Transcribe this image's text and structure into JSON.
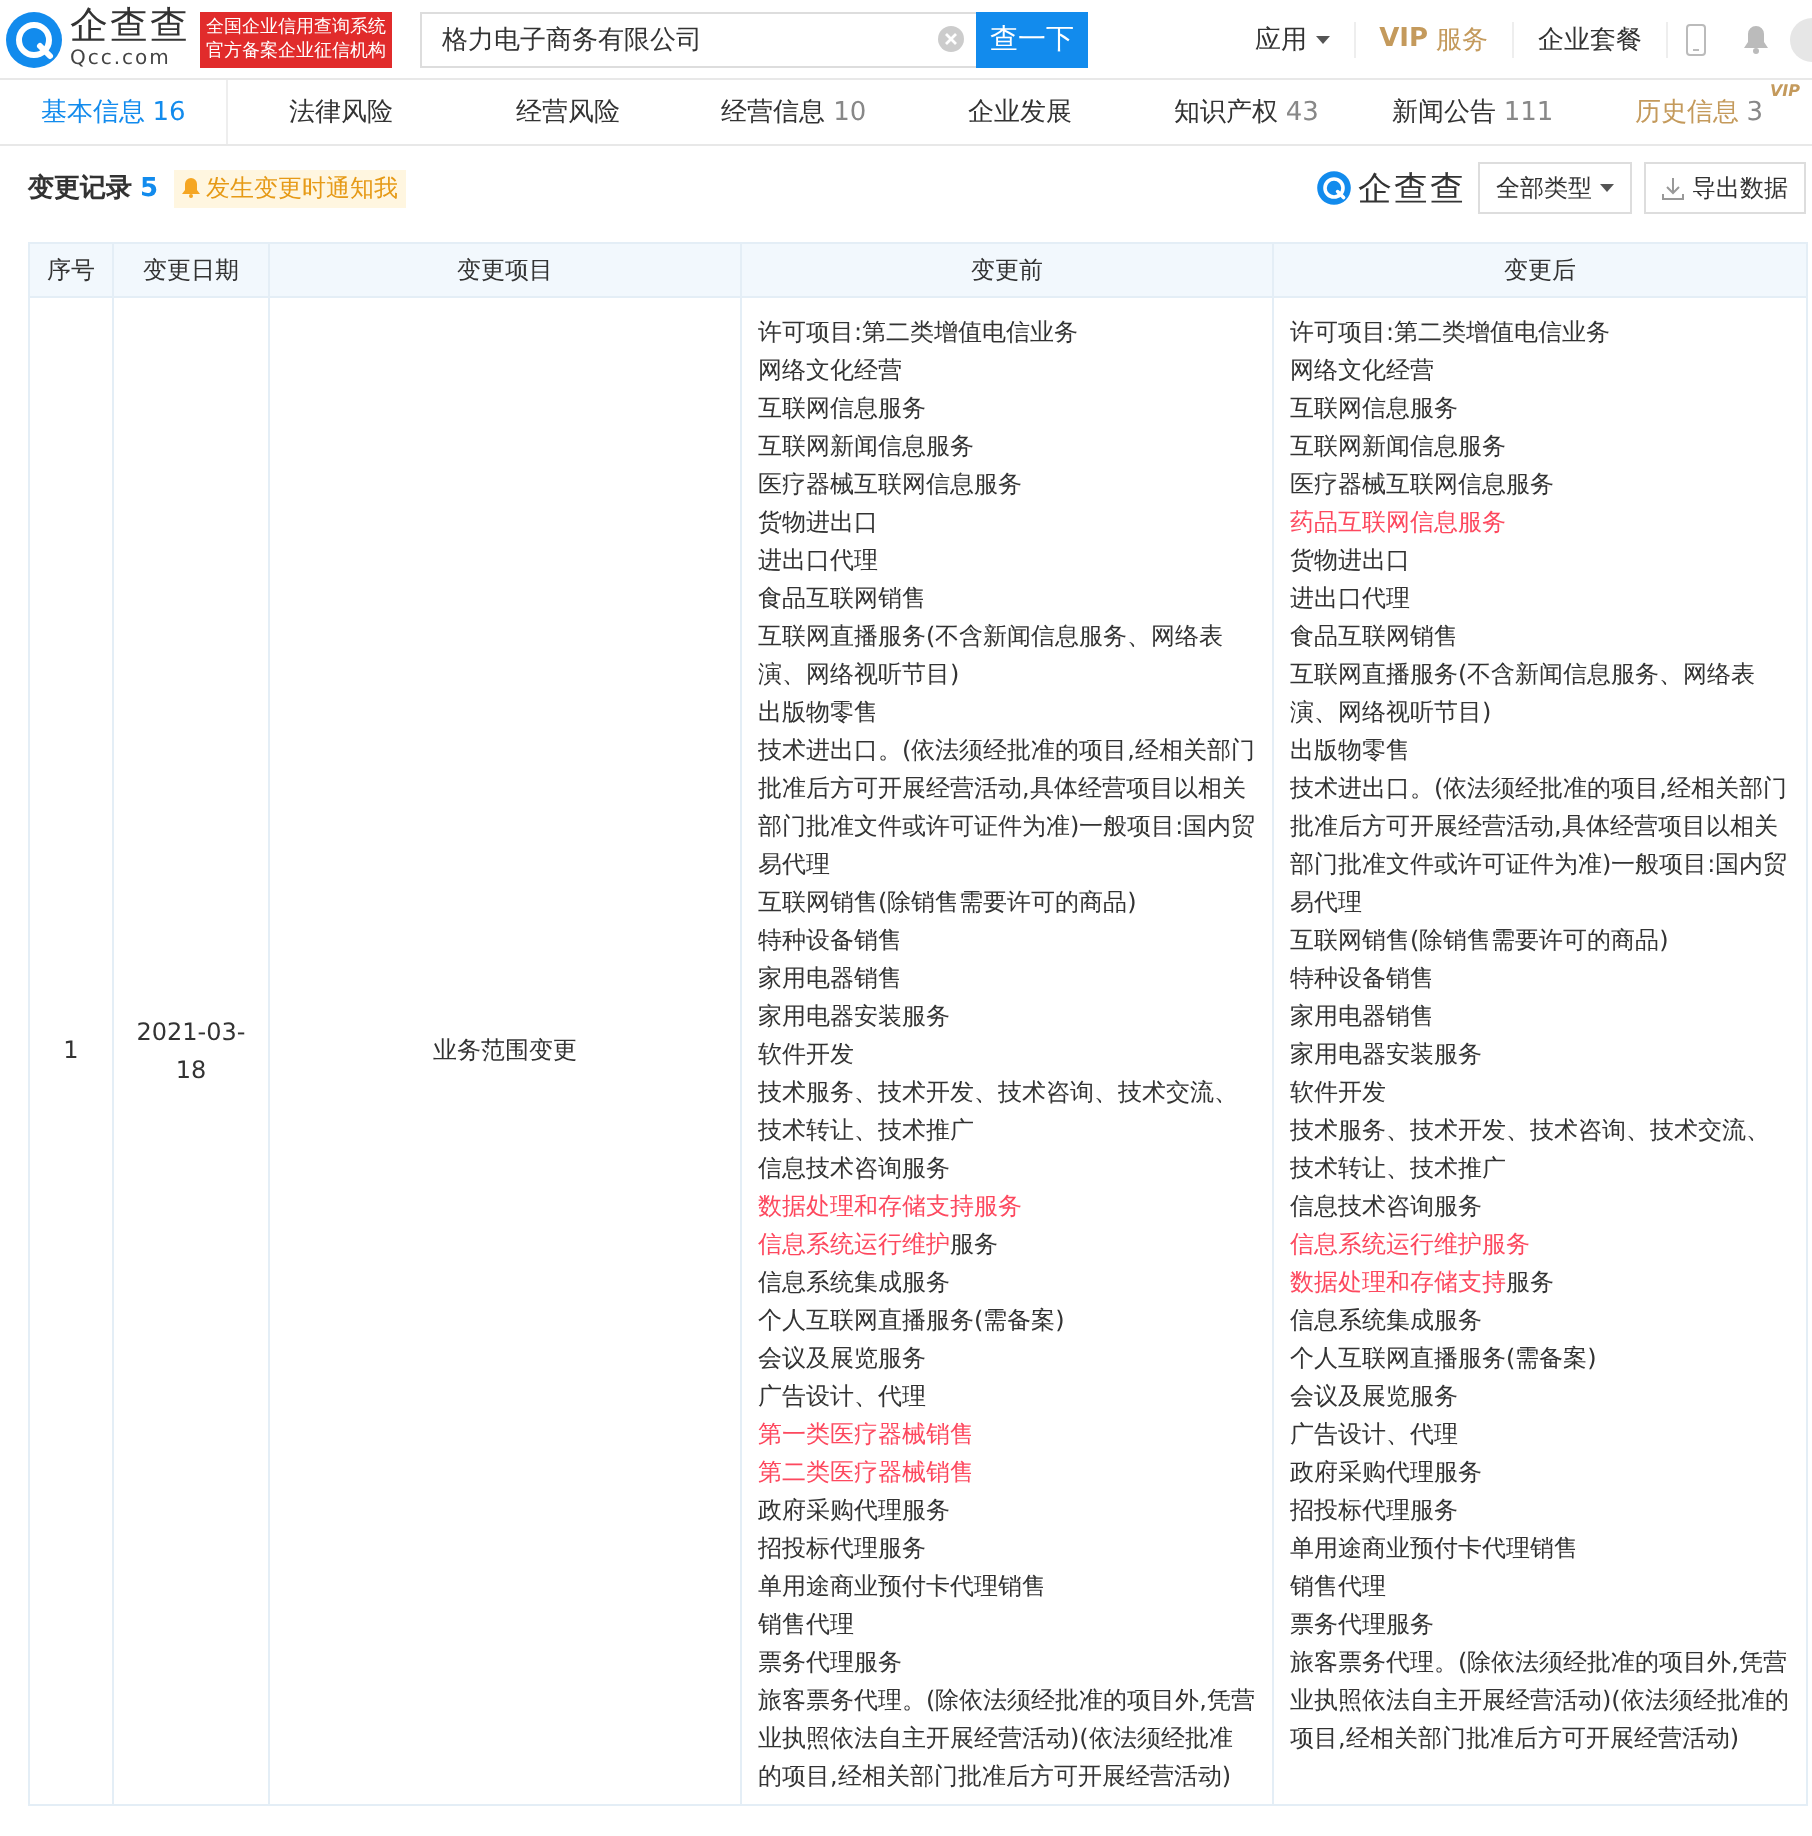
{
  "header": {
    "logo": {
      "name": "企查查",
      "domain": "Qcc.com"
    },
    "badge": [
      "全国企业信用查询系统",
      "官方备案企业征信机构"
    ],
    "search": {
      "value": "格力电子商务有限公司",
      "button": "查一下"
    },
    "menu": [
      {
        "label": "应用",
        "kind": "dropdown"
      },
      {
        "label": "**VIP**服务",
        "kind": "vip"
      },
      {
        "label": "企业套餐",
        "kind": "link"
      }
    ]
  },
  "tabs": [
    {
      "label": "基本信息",
      "count": "16",
      "selected": true
    },
    {
      "label": "法律风险",
      "selected": false
    },
    {
      "label": "经营风险",
      "selected": false
    },
    {
      "label": "经营信息",
      "count": "10",
      "selected": false
    },
    {
      "label": "企业发展",
      "selected": false
    },
    {
      "label": "知识产权",
      "count": "43",
      "selected": false
    },
    {
      "label": "新闻公告",
      "count": "111",
      "selected": false
    },
    {
      "label": "历史信息",
      "count": "3",
      "selected": false,
      "badge": "VIP"
    }
  ],
  "section": {
    "title": "变更记录",
    "count": "5",
    "notify": "发生变更时通知我",
    "brand": "企查查",
    "filter": "全部类型",
    "export": "导出数据"
  },
  "table": {
    "columns": [
      "序号",
      "变更日期",
      "变更项目",
      "变更前",
      "变更后"
    ],
    "rows": [
      {
        "index": "1",
        "date": "2021-03-18",
        "item": "业务范围变更",
        "before": [
          {
            "text": "许可项目:第二类增值电信业务",
            "changed": false
          },
          {
            "text": "网络文化经营",
            "changed": false
          },
          {
            "text": "互联网信息服务",
            "changed": false
          },
          {
            "text": "互联网新闻信息服务",
            "changed": false
          },
          {
            "text": "医疗器械互联网信息服务",
            "changed": false
          },
          {
            "text": "货物进出口",
            "changed": false
          },
          {
            "text": "进出口代理",
            "changed": false
          },
          {
            "text": "食品互联网销售",
            "changed": false
          },
          {
            "text": "互联网直播服务(不含新闻信息服务、网络表演、网络视听节目)",
            "changed": false
          },
          {
            "text": "出版物零售",
            "changed": false
          },
          {
            "text": "技术进出口。(依法须经批准的项目,经相关部门批准后方可开展经营活动,具体经营项目以相关部门批准文件或许可证件为准)一般项目:国内贸易代理",
            "changed": false
          },
          {
            "text": "互联网销售(除销售需要许可的商品)",
            "changed": false
          },
          {
            "text": "特种设备销售",
            "changed": false
          },
          {
            "text": "家用电器销售",
            "changed": false
          },
          {
            "text": "家用电器安装服务",
            "changed": false
          },
          {
            "text": "软件开发",
            "changed": false
          },
          {
            "text": "技术服务、技术开发、技术咨询、技术交流、技术转让、技术推广",
            "changed": false
          },
          {
            "text": "信息技术咨询服务",
            "changed": false
          },
          {
            "text": "数据处理和存储支持服务",
            "changed": true
          },
          {
            "text": "信息系统运行维护",
            "changed": true,
            "tail": "服务"
          },
          {
            "text": "信息系统集成服务",
            "changed": false
          },
          {
            "text": "个人互联网直播服务(需备案)",
            "changed": false
          },
          {
            "text": "会议及展览服务",
            "changed": false
          },
          {
            "text": "广告设计、代理",
            "changed": false
          },
          {
            "text": "第一类医疗器械销售",
            "changed": true
          },
          {
            "text": "第二类医疗器械销售",
            "changed": true
          },
          {
            "text": "政府采购代理服务",
            "changed": false
          },
          {
            "text": "招投标代理服务",
            "changed": false
          },
          {
            "text": "单用途商业预付卡代理销售",
            "changed": false
          },
          {
            "text": "销售代理",
            "changed": false
          },
          {
            "text": "票务代理服务",
            "changed": false
          },
          {
            "text": "旅客票务代理。(除依法须经批准的项目外,凭营业执照依法自主开展经营活动)(依法须经批准的项目,经相关部门批准后方可开展经营活动)",
            "changed": false
          }
        ],
        "after": [
          {
            "text": "许可项目:第二类增值电信业务",
            "changed": false
          },
          {
            "text": "网络文化经营",
            "changed": false
          },
          {
            "text": "互联网信息服务",
            "changed": false
          },
          {
            "text": "互联网新闻信息服务",
            "changed": false
          },
          {
            "text": "医疗器械互联网信息服务",
            "changed": false
          },
          {
            "text": "药品互联网信息服务",
            "changed": true
          },
          {
            "text": "货物进出口",
            "changed": false
          },
          {
            "text": "进出口代理",
            "changed": false
          },
          {
            "text": "食品互联网销售",
            "changed": false
          },
          {
            "text": "互联网直播服务(不含新闻信息服务、网络表演、网络视听节目)",
            "changed": false
          },
          {
            "text": "出版物零售",
            "changed": false
          },
          {
            "text": "技术进出口。(依法须经批准的项目,经相关部门批准后方可开展经营活动,具体经营项目以相关部门批准文件或许可证件为准)一般项目:国内贸易代理",
            "changed": false
          },
          {
            "text": "互联网销售(除销售需要许可的商品)",
            "changed": false
          },
          {
            "text": "特种设备销售",
            "changed": false
          },
          {
            "text": "家用电器销售",
            "changed": false
          },
          {
            "text": "家用电器安装服务",
            "changed": false
          },
          {
            "text": "软件开发",
            "changed": false
          },
          {
            "text": "技术服务、技术开发、技术咨询、技术交流、技术转让、技术推广",
            "changed": false
          },
          {
            "text": "信息技术咨询服务",
            "changed": false
          },
          {
            "text": "信息系统运行维护服务",
            "changed": true
          },
          {
            "text": "数据处理和存储支持",
            "changed": true,
            "tail": "服务"
          },
          {
            "text": "信息系统集成服务",
            "changed": false
          },
          {
            "text": "个人互联网直播服务(需备案)",
            "changed": false
          },
          {
            "text": "会议及展览服务",
            "changed": false
          },
          {
            "text": "广告设计、代理",
            "changed": false
          },
          {
            "text": "政府采购代理服务",
            "changed": false
          },
          {
            "text": "招投标代理服务",
            "changed": false
          },
          {
            "text": "单用途商业预付卡代理销售",
            "changed": false
          },
          {
            "text": "销售代理",
            "changed": false
          },
          {
            "text": "票务代理服务",
            "changed": false
          },
          {
            "text": "旅客票务代理。(除依法须经批准的项目外,凭营业执照依法自主开展经营活动)(依法须经批准的项目,经相关部门批准后方可开展经营活动)",
            "changed": false
          }
        ]
      }
    ]
  }
}
